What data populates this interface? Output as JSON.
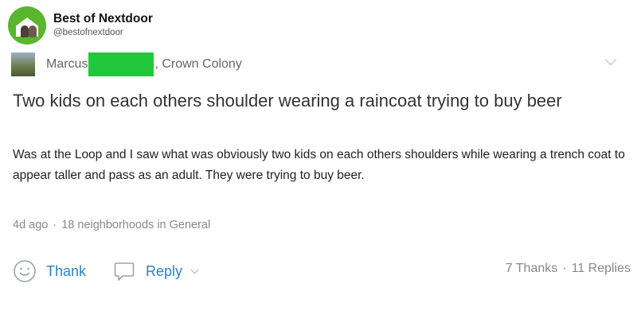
{
  "tweet": {
    "account_name": "Best of Nextdoor",
    "handle": "@bestofnextdoor"
  },
  "post": {
    "author_name": "Marcus",
    "author_location": ", Crown Colony",
    "redaction_color": "#21c93a",
    "title": "Two kids on each others shoulder wearing a raincoat trying to buy beer",
    "body": "Was at the Loop and I saw what was obviously two kids on each others shoulders while wearing a trench coat to appear taller and pass as an adult. They were trying to buy beer.",
    "meta": {
      "time": "4d ago",
      "separator": "·",
      "audience": "18 neighborhoods in General"
    },
    "actions": {
      "thank_label": "Thank",
      "reply_label": "Reply"
    },
    "stats": {
      "thanks": "7 Thanks",
      "separator": "·",
      "replies": "11 Replies"
    }
  },
  "colors": {
    "link_blue": "#2a82c5",
    "brand_green": "#5ab52f"
  },
  "icons": [
    "smile-icon",
    "reply-bubble-icon",
    "chevron-down-icon"
  ]
}
